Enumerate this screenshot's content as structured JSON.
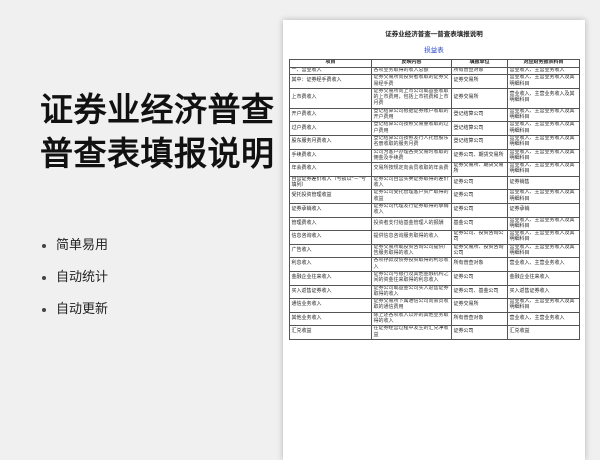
{
  "headline": {
    "line1": "证券业经济普查",
    "line2": "普查表填报说明"
  },
  "features": [
    "简单易用",
    "自动统计",
    "自动更新"
  ],
  "document": {
    "title": "证券业经济普查一普查表填报说明",
    "subtitle": "损益表",
    "columns": [
      "项目",
      "反映内容",
      "填报单位",
      "对应财务报表科目"
    ],
    "rows": [
      [
        "一、营业收入",
        "各项业务取得的收入总额",
        "所有普查对象",
        "营业收入、主营业务收入"
      ],
      [
        "其中：证券经手费收入",
        "证券交易所向投资者收取的证券交易经手费",
        "证券交易所",
        "营业收入、主营业务收入及其明细科目"
      ],
      [
        "上市费收入",
        "证券交易所向上市公司或基金收取的上市费用，包括上市初费和上市月费",
        "证券交易所",
        "营业收入、主营业务收入及其明细科目"
      ],
      [
        "开户费收入",
        "登记结算公司根据证券账户收取的开户费用",
        "登记结算公司",
        "营业收入、主营业务收入及其明细科目"
      ],
      [
        "过户费收入",
        "登记结算公司按照交易量收取的过户费用",
        "登记结算公司",
        "营业收入、主营业务收入及其明细科目"
      ],
      [
        "股东服务月费收入",
        "登记结算公司按照发行人托管股东名册收取的服务月费",
        "登记结算公司",
        "营业收入、主营业务收入及其明细科目"
      ],
      [
        "手续费收入",
        "公司为客户办理各类交易时收取的佣金及手续费",
        "证券公司、期货交易所",
        "营业收入、主营业务收入及其明细科目"
      ],
      [
        "年会费收入",
        "交易所按规定向会员收取的年会费",
        "证券交易所、期货交易所",
        "营业收入、主营业务收入及其明细科目"
      ],
      [
        "自营证券差价收入（亏损以“－”号填列）",
        "证券公司自营买卖证券取得的差价收入",
        "证券公司",
        "证券销售"
      ],
      [
        "受托投资管理收益",
        "证券公司受托管理客户资产取得的收益",
        "证券公司",
        "营业收入、主营业务收入及其明细科目"
      ],
      [
        "证券承销收入",
        "证券公司代理发行证券取得的承销收入",
        "证券公司",
        "证券承销"
      ],
      [
        "管理费收入",
        "投资者支付给基金管理人的报酬",
        "基金公司",
        "营业收入、主营业务收入及其明细科目"
      ],
      [
        "信息咨询收入",
        "提供信息咨询服务取得的收入",
        "证券公司、投资咨询公司",
        "营业收入、主营业务收入及其明细科目"
      ],
      [
        "广告收入",
        "证券交易所或投资咨询公司提供广告服务取得的收入",
        "证券交易所、投资咨询公司",
        "营业收入、主营业务收入及其明细科目"
      ],
      [
        "利息收入",
        "各项存款及债券投资取得的利息收入",
        "所有普查对象",
        "营业收入、主营业务收入"
      ],
      [
        "金融企业往来收入",
        "证券公司与银行及其他金融机构之间的资金往来取得的利息收入",
        "证券公司",
        "金融企业往来收入"
      ],
      [
        "买入返售证券收入",
        "证券公司或基金公司买入返售证券取得的收入",
        "证券公司、基金公司",
        "买入返售证券收入"
      ],
      [
        "通信业务收入",
        "证券交易所下属通信公司向会员收取的通信费用",
        "证券交易所",
        "营业收入、主营业务收入及其明细科目"
      ],
      [
        "其他业务收入",
        "除上述各项收入以外的其他业务取得的收入",
        "所有普查对象",
        "营业收入、主营业务收入"
      ],
      [
        "汇兑收益",
        "在证券经营过程中发生的汇兑净收益",
        "证券公司",
        "汇兑收益"
      ]
    ]
  }
}
